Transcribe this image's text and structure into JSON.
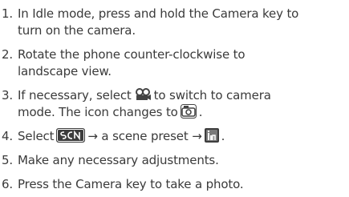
{
  "steps": [
    {
      "num": "1.",
      "lines": [
        "In Idle mode, press and hold the Camera key to",
        "turn on the camera."
      ]
    },
    {
      "num": "2.",
      "lines": [
        "Rotate the phone counter-clockwise to",
        "landscape view."
      ]
    },
    {
      "num": "3.",
      "line1_a": "If necessary, select",
      "line1_b": "to switch to camera",
      "line2_a": "mode. The icon changes to",
      "line2_b": "."
    },
    {
      "num": "4.",
      "a": "Select",
      "b": "→ a scene preset →",
      "c": "."
    },
    {
      "num": "5.",
      "lines": [
        "Make any necessary adjustments."
      ]
    },
    {
      "num": "6.",
      "lines": [
        "Press the Camera key to take a photo."
      ]
    }
  ],
  "icons": {
    "camcorder_switch": "camcorder-mode-icon",
    "camera_mode": "camera-mode-icon",
    "scene": "scene-mode-icon",
    "landscape_preset": "landscape-preset-icon"
  }
}
